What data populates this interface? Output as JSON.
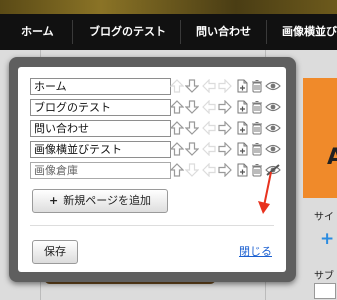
{
  "nav": {
    "items": [
      "ホーム",
      "ブログのテスト",
      "問い合わせ",
      "画像横並びテ"
    ]
  },
  "background": {
    "orange_letter": "A",
    "side_label_1": "サイ",
    "side_plus": "+",
    "side_label_2": "サブ"
  },
  "dialog": {
    "pages": [
      {
        "name": "ホーム",
        "visible": true
      },
      {
        "name": "ブログのテスト",
        "visible": true
      },
      {
        "name": "問い合わせ",
        "visible": true
      },
      {
        "name": "画像横並びテスト",
        "visible": true
      },
      {
        "name": "画像倉庫",
        "visible": false
      }
    ],
    "add_page_plus": "+",
    "add_page_label": "新規ページを追加",
    "save_label": "保存",
    "close_label": "閉じる"
  },
  "colors": {
    "arrow_active": "#9a9a9a",
    "arrow_disabled": "#dcdcdc",
    "link": "#1a5fd0",
    "annotation_arrow": "#e8321e",
    "navbar": "#111111"
  }
}
